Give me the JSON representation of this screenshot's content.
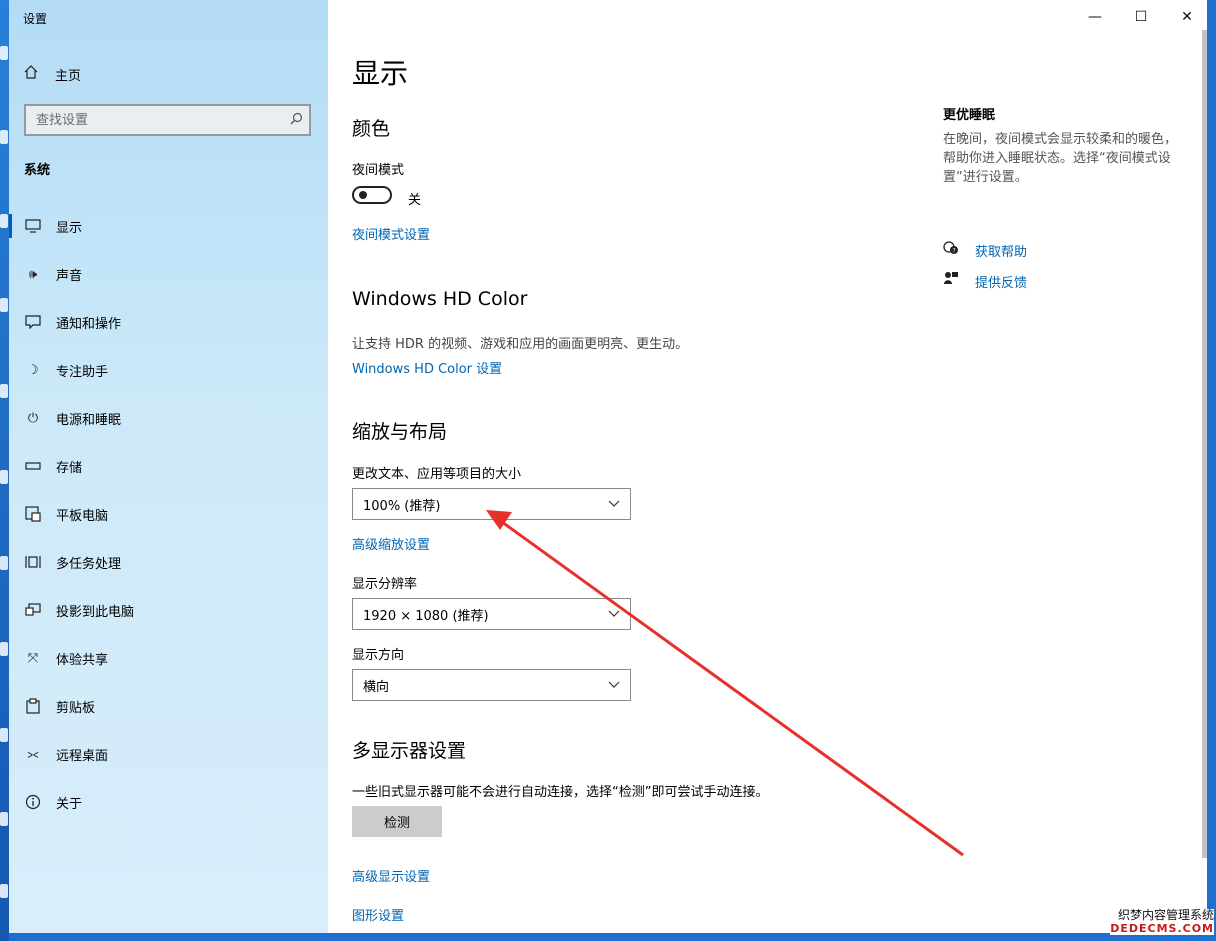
{
  "window": {
    "title": "设置",
    "controls": {
      "minimize": "—",
      "maximize": "☐",
      "close": "✕"
    }
  },
  "sidebar": {
    "home_label": "主页",
    "search": {
      "placeholder": "查找设置",
      "value": ""
    },
    "section_label": "系统",
    "items": [
      {
        "label": "显示",
        "icon": "monitor-icon",
        "active": true
      },
      {
        "label": "声音",
        "icon": "speaker-icon"
      },
      {
        "label": "通知和操作",
        "icon": "notification-icon"
      },
      {
        "label": "专注助手",
        "icon": "moon-icon"
      },
      {
        "label": "电源和睡眠",
        "icon": "power-icon"
      },
      {
        "label": "存储",
        "icon": "storage-icon"
      },
      {
        "label": "平板电脑",
        "icon": "tablet-icon"
      },
      {
        "label": "多任务处理",
        "icon": "multitask-icon"
      },
      {
        "label": "投影到此电脑",
        "icon": "projection-icon"
      },
      {
        "label": "体验共享",
        "icon": "share-icon"
      },
      {
        "label": "剪贴板",
        "icon": "clipboard-icon"
      },
      {
        "label": "远程桌面",
        "icon": "remote-icon"
      },
      {
        "label": "关于",
        "icon": "info-icon"
      }
    ]
  },
  "main": {
    "title": "显示",
    "color": {
      "heading": "颜色",
      "night_mode_label": "夜间模式",
      "night_mode_state": "关",
      "night_mode_on": false,
      "night_mode_link": "夜间模式设置"
    },
    "hdr": {
      "heading": "Windows HD Color",
      "description": "让支持 HDR 的视频、游戏和应用的画面更明亮、更生动。",
      "link": "Windows HD Color 设置"
    },
    "scale": {
      "heading": "缩放与布局",
      "size_label": "更改文本、应用等项目的大小",
      "size_value": "100% (推荐)",
      "advanced_link": "高级缩放设置",
      "resolution_label": "显示分辨率",
      "resolution_value": "1920 × 1080 (推荐)",
      "orientation_label": "显示方向",
      "orientation_value": "横向"
    },
    "multi": {
      "heading": "多显示器设置",
      "description": "一些旧式显示器可能不会进行自动连接，选择“检测”即可尝试手动连接。",
      "detect_button": "检测",
      "advanced_display_link": "高级显示设置",
      "graphics_link": "图形设置"
    }
  },
  "right_panel": {
    "title": "更优睡眠",
    "description": "在晚间，夜间模式会显示较柔和的暖色，帮助你进入睡眠状态。选择“夜间模式设置”进行设置。",
    "help_link": "获取帮助",
    "feedback_link": "提供反馈"
  },
  "watermark": {
    "line1": "织梦内容管理系统",
    "line2": "DEDECMS.COM"
  },
  "annotation_arrow_color": "#e8302a"
}
